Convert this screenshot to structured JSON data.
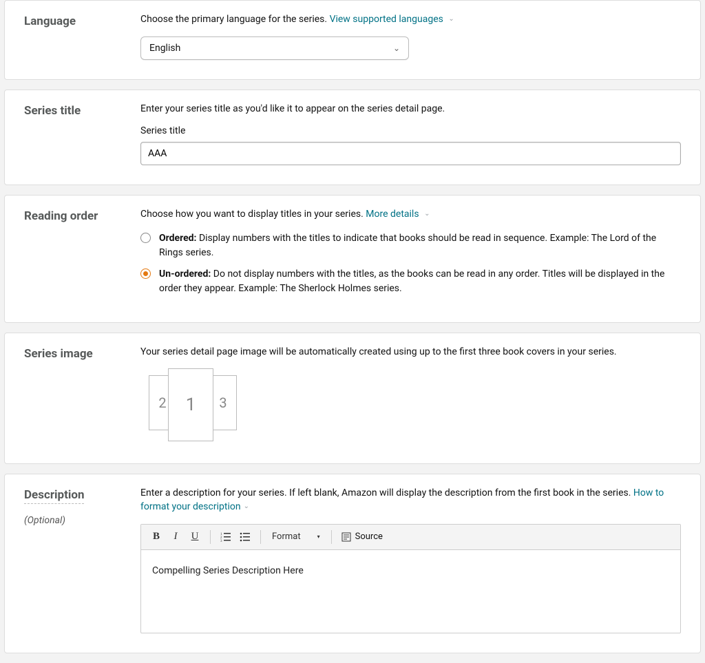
{
  "language": {
    "heading": "Language",
    "helper": "Choose the primary language for the series.",
    "link": "View supported languages",
    "selected": "English"
  },
  "series_title": {
    "heading": "Series title",
    "helper": "Enter your series title as you'd like it to appear on the series detail page.",
    "field_label": "Series title",
    "value": "AAA"
  },
  "reading_order": {
    "heading": "Reading order",
    "helper": "Choose how you want to display titles in your series.",
    "link": "More details",
    "options": [
      {
        "bold": "Ordered:",
        "rest": " Display numbers with the titles to indicate that books should be read in sequence. Example: The Lord of the Rings series.",
        "checked": false
      },
      {
        "bold": "Un-ordered:",
        "rest": " Do not display numbers with the titles, as the books can be read in any order. Titles will be displayed in the order they appear. Example: The Sherlock Holmes series.",
        "checked": true
      }
    ]
  },
  "series_image": {
    "heading": "Series image",
    "helper": "Your series detail page image will be automatically created using up to the first three book covers in your series.",
    "covers": {
      "left": "2",
      "front": "1",
      "right": "3"
    }
  },
  "description": {
    "heading": "Description",
    "optional": "(Optional)",
    "helper_pre": "Enter a description for your series. If left blank, Amazon will display the description from the first book in the series. ",
    "link": "How to format your description",
    "toolbar": {
      "bold": "B",
      "italic": "I",
      "underline": "U",
      "format": "Format",
      "source": "Source"
    },
    "body": "Compelling Series Description Here"
  }
}
